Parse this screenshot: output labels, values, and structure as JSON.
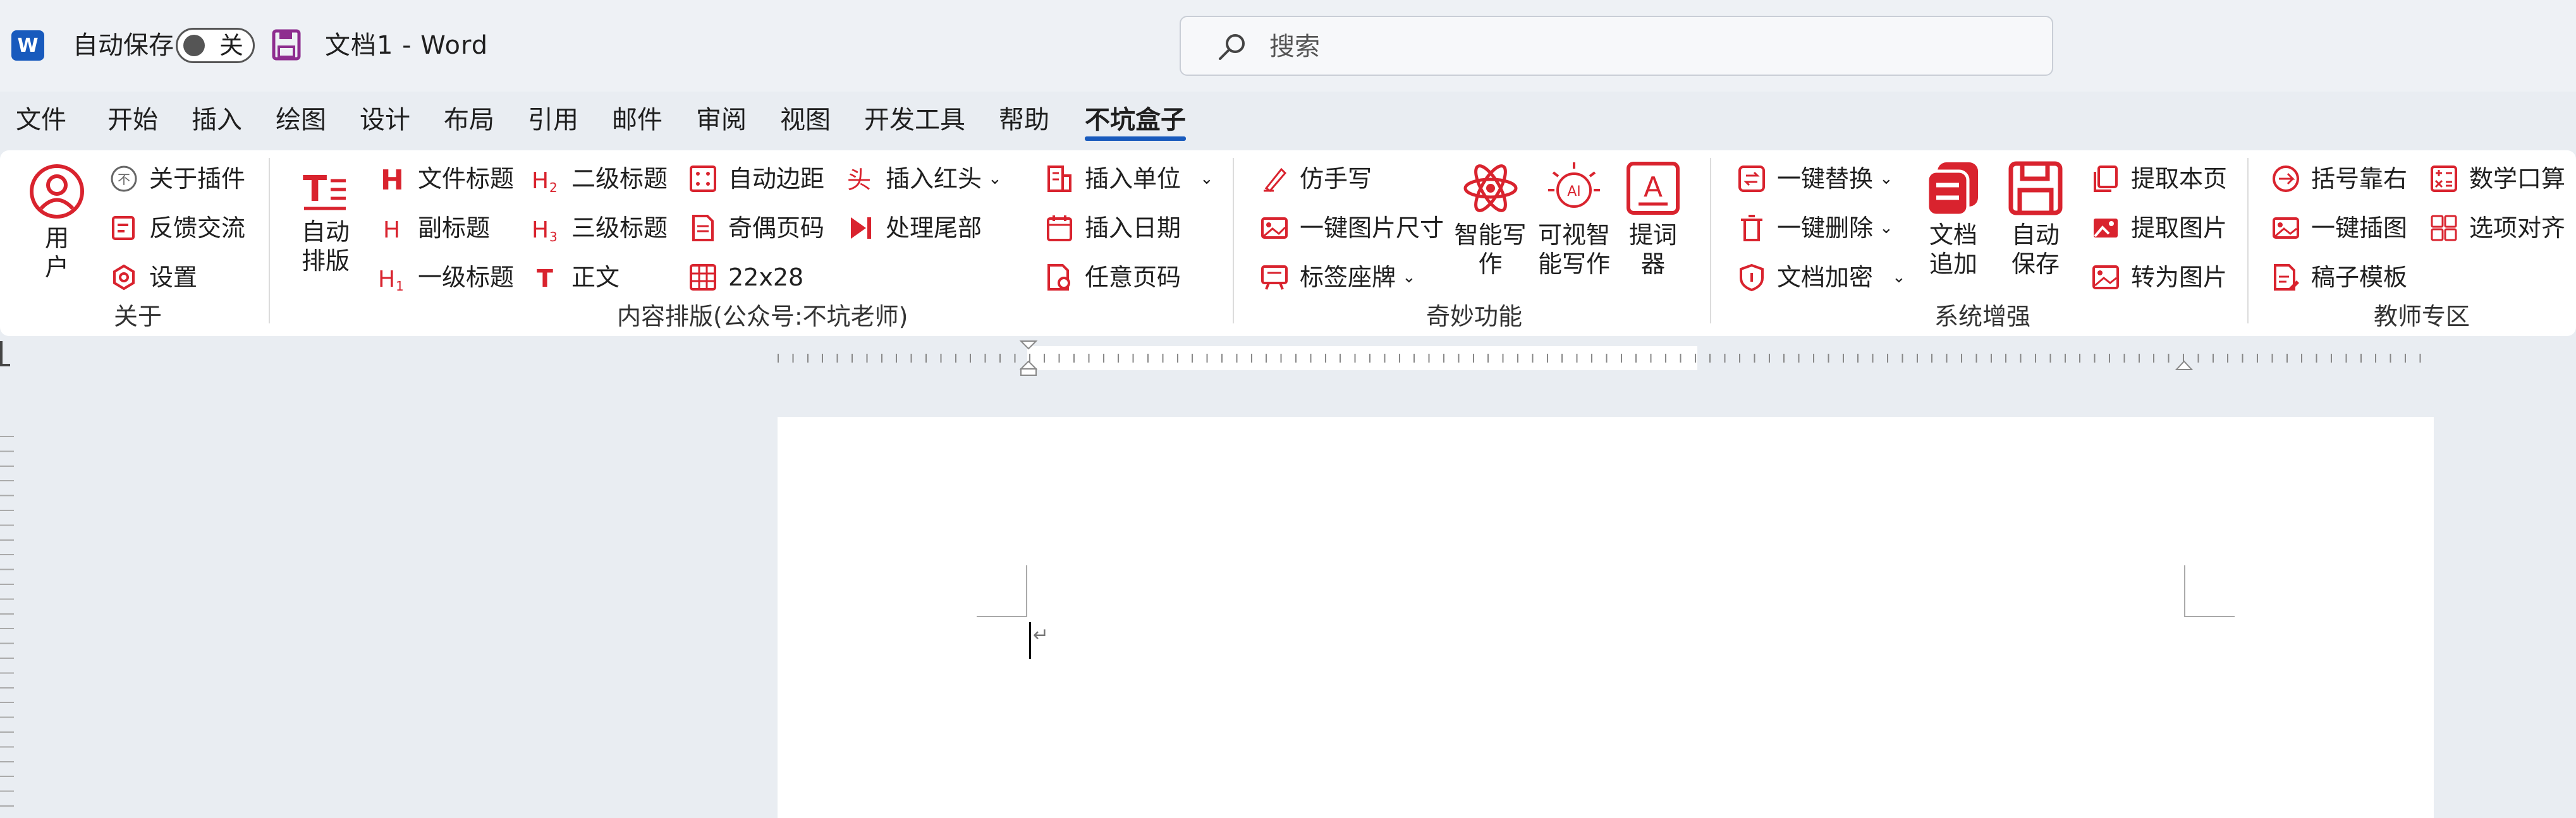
{
  "titlebar": {
    "app_logo": "W",
    "autosave_label": "自动保存",
    "autosave_state": "关",
    "doc_title": "文档1  -  Word",
    "search_placeholder": "搜索"
  },
  "tabs": [
    "文件",
    "开始",
    "插入",
    "绘图",
    "设计",
    "布局",
    "引用",
    "邮件",
    "审阅",
    "视图",
    "开发工具",
    "帮助",
    "不坑盒子"
  ],
  "active_tab": "不坑盒子",
  "ribbon": {
    "about": {
      "user_label": "用户",
      "plugin_about": "关于插件",
      "feedback": "反馈交流",
      "settings": "设置",
      "group": "关于"
    },
    "content": {
      "auto_layout": "自动排版",
      "doc_title": "文件标题",
      "subtitle": "副标题",
      "h1": "一级标题",
      "h2": "二级标题",
      "h3": "三级标题",
      "body": "正文",
      "auto_margin": "自动边距",
      "odd_even_page": "奇偶页码",
      "grid": "22x28",
      "red_header": "插入红头",
      "tail": "处理尾部",
      "insert_unit": "插入单位",
      "insert_date": "插入日期",
      "any_page_no": "任意页码",
      "group": "内容排版(公众号:不坑老师)"
    },
    "magic": {
      "imitate_handwriting": "仿手写",
      "image_size": "一键图片尺寸",
      "label_seat": "标签座牌",
      "smart_write": "智能写作",
      "visual_write": "可视智能写作",
      "teleprompter": "提词器",
      "group": "奇妙功能"
    },
    "system": {
      "replace": "一键替换",
      "delete": "一键删除",
      "encrypt": "文档加密",
      "doc_append": "文档追加",
      "auto_save": "自动保存",
      "extract_page": "提取本页",
      "extract_image": "提取图片",
      "to_image": "转为图片",
      "group": "系统增强"
    },
    "teacher": {
      "bracket_right": "括号靠右",
      "insert_image": "一键插图",
      "manuscript": "稿子模板",
      "math_oral": "数学口算",
      "option_align": "选项对齐",
      "group": "教师专区"
    }
  },
  "colors": {
    "accent": "#d9232e",
    "word_blue": "#185abd",
    "save_purple": "#8e2d8f"
  }
}
